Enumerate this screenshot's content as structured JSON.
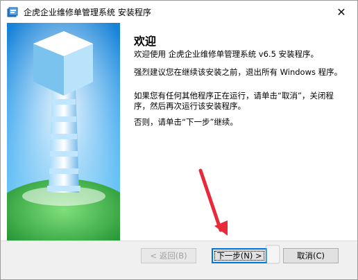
{
  "window": {
    "title": "企虎企业维修单管理系统 安装程序",
    "close_glyph": "✕"
  },
  "content": {
    "heading": "欢迎",
    "paragraph1": "欢迎使用 企虎企业维修单管理系统 v6.5 安装程序。",
    "paragraph2": "强烈建议您在继续该安装之前，退出所有 Windows 程序。",
    "paragraph3": "如果您有任何其他程序正在运行，请单击“取消”，关闭程序，然后再次运行该安装程序。",
    "paragraph4": "否则，请单击“下一步”继续。"
  },
  "buttons": {
    "back_label": "< 返回(B)",
    "next_label": "下一步(N) >",
    "cancel_label": "取消(C)"
  },
  "colors": {
    "arrow": "#e8293a",
    "accent": "#0078d7"
  },
  "icons": {
    "app": "installer-icon",
    "close": "close-icon",
    "annotation": "red-arrow-icon"
  }
}
